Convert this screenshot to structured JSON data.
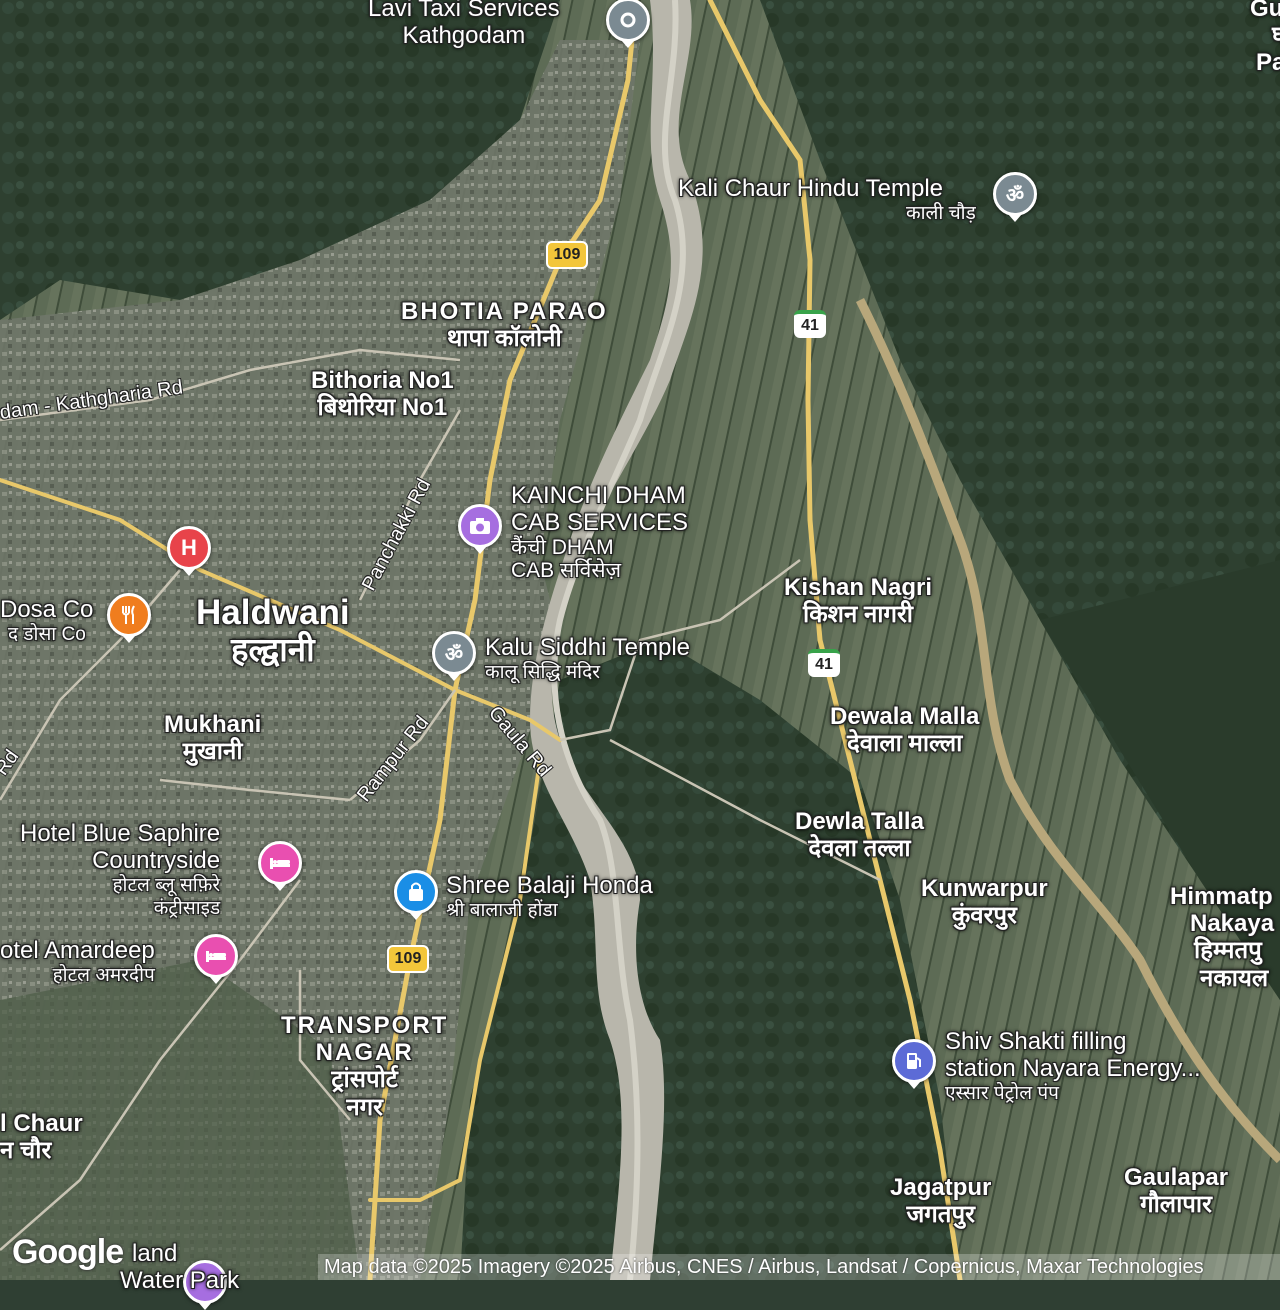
{
  "map": {
    "type": "satellite",
    "labels": {
      "lavi": {
        "title": "Lavi Taxi Services",
        "title2": "Kathgodam"
      },
      "kali_chaur": {
        "title": "Kali Chaur Hindu Temple",
        "sub": "काली चौड़"
      },
      "bhotia": {
        "title": "BHOTIA PARAO",
        "sub": "थापा कॉलोनी"
      },
      "bithoria": {
        "title": "Bithoria No1",
        "sub": "बिथोरिया No1"
      },
      "kainchi": {
        "title": "KAINCHI DHAM",
        "title2": "CAB SERVICES",
        "sub": "कैंची DHAM",
        "sub2": "CAB सर्विसेज़"
      },
      "haldwani": {
        "title": "Haldwani",
        "sub": "हल्द्वानी"
      },
      "dosa": {
        "title": "Dosa Co",
        "sub": "द डोसा Co"
      },
      "kalu": {
        "title": "Kalu Siddhi Temple",
        "sub": "कालू सिद्धि मंदिर"
      },
      "kishan": {
        "title": "Kishan Nagri",
        "sub": "किशन नागरी"
      },
      "mukhani": {
        "title": "Mukhani",
        "sub": "मुखानी"
      },
      "dewala_malla": {
        "title": "Dewala Malla",
        "sub": "देवाला माल्ला"
      },
      "dewla_talla": {
        "title": "Dewla Talla",
        "sub": "देवला तल्ला"
      },
      "blue_saphire": {
        "title": "Hotel Blue Saphire",
        "title2": "Countryside",
        "sub": "होटल ब्लू सफ़िरे",
        "sub2": "कंट्रीसाइड"
      },
      "balaji": {
        "title": "Shree Balaji Honda",
        "sub": "श्री बालाजी होंडा"
      },
      "kunwarpur": {
        "title": "Kunwarpur",
        "sub": "कुंवरपुर"
      },
      "himmatpur": {
        "title": "Himmatp",
        "title2": "Nakaya",
        "sub": "हिम्मतपु",
        "sub2": "नकायल"
      },
      "amardeep": {
        "title": "otel Amardeep",
        "sub": "होटल अमरदीप"
      },
      "transport": {
        "title": "TRANSPORT",
        "title2": "NAGAR",
        "sub": "ट्रांसपोर्ट",
        "sub2": "नगर"
      },
      "shiv_shakti": {
        "title": "Shiv Shakti filling",
        "title2": "station Nayara Energy...",
        "sub": "एस्सार पेट्रोल पंप"
      },
      "chaur": {
        "title": "l Chaur",
        "sub": "न चौर"
      },
      "jagatpur": {
        "title": "Jagatpur",
        "sub": "जगतपुर"
      },
      "gaulapar": {
        "title": "Gaulapar",
        "sub": "गौलापार"
      },
      "water_park": {
        "title": "land",
        "title2": "Water Park"
      },
      "top_right": {
        "title": "Gu",
        "title2": "घ",
        "title3": "Pa"
      }
    },
    "roads": {
      "kathgharia": "dam - Kathgharia Rd",
      "panchakki": "Panchakki Rd",
      "gaula": "Gaula Rd",
      "rampur": "Rampur Rd",
      "rd_left": "Rd"
    },
    "shields": {
      "sh109_top": "109",
      "sh109_bottom": "109",
      "nh41_top": "41",
      "nh41_mid": "41"
    },
    "icons": {
      "lavi": "place-pin-icon",
      "kali_chaur": "om-temple-icon",
      "kainchi": "camera-icon",
      "hospital": "hospital-icon",
      "dosa": "restaurant-icon",
      "kalu": "om-temple-icon",
      "blue_saphire": "hotel-icon",
      "balaji": "shopping-bag-icon",
      "amardeep": "hotel-icon",
      "shiv_shakti": "fuel-icon",
      "water_park": "amusement-icon"
    },
    "hospital_glyph": "H",
    "colors": {
      "temple": "#7b8a92",
      "camera": "#a66ee0",
      "hospital": "#e8434a",
      "restaurant": "#f07d1e",
      "hotel": "#e94fb0",
      "shopping": "#1a8ee6",
      "fuel": "#5c6bd6",
      "road": "#e8c86a"
    }
  },
  "footer": {
    "logo": "Google",
    "attribution": "Map data ©2025 Imagery ©2025 Airbus, CNES / Airbus, Landsat / Copernicus, Maxar Technologies"
  }
}
